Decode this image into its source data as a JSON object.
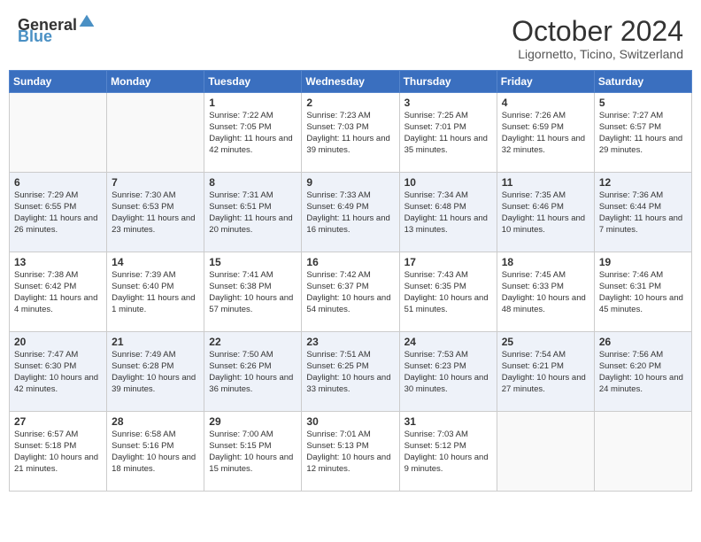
{
  "header": {
    "logo_general": "General",
    "logo_blue": "Blue",
    "month_title": "October 2024",
    "location": "Ligornetto, Ticino, Switzerland"
  },
  "days_of_week": [
    "Sunday",
    "Monday",
    "Tuesday",
    "Wednesday",
    "Thursday",
    "Friday",
    "Saturday"
  ],
  "weeks": [
    [
      {
        "day": "",
        "sunrise": "",
        "sunset": "",
        "daylight": ""
      },
      {
        "day": "",
        "sunrise": "",
        "sunset": "",
        "daylight": ""
      },
      {
        "day": "1",
        "sunrise": "Sunrise: 7:22 AM",
        "sunset": "Sunset: 7:05 PM",
        "daylight": "Daylight: 11 hours and 42 minutes."
      },
      {
        "day": "2",
        "sunrise": "Sunrise: 7:23 AM",
        "sunset": "Sunset: 7:03 PM",
        "daylight": "Daylight: 11 hours and 39 minutes."
      },
      {
        "day": "3",
        "sunrise": "Sunrise: 7:25 AM",
        "sunset": "Sunset: 7:01 PM",
        "daylight": "Daylight: 11 hours and 35 minutes."
      },
      {
        "day": "4",
        "sunrise": "Sunrise: 7:26 AM",
        "sunset": "Sunset: 6:59 PM",
        "daylight": "Daylight: 11 hours and 32 minutes."
      },
      {
        "day": "5",
        "sunrise": "Sunrise: 7:27 AM",
        "sunset": "Sunset: 6:57 PM",
        "daylight": "Daylight: 11 hours and 29 minutes."
      }
    ],
    [
      {
        "day": "6",
        "sunrise": "Sunrise: 7:29 AM",
        "sunset": "Sunset: 6:55 PM",
        "daylight": "Daylight: 11 hours and 26 minutes."
      },
      {
        "day": "7",
        "sunrise": "Sunrise: 7:30 AM",
        "sunset": "Sunset: 6:53 PM",
        "daylight": "Daylight: 11 hours and 23 minutes."
      },
      {
        "day": "8",
        "sunrise": "Sunrise: 7:31 AM",
        "sunset": "Sunset: 6:51 PM",
        "daylight": "Daylight: 11 hours and 20 minutes."
      },
      {
        "day": "9",
        "sunrise": "Sunrise: 7:33 AM",
        "sunset": "Sunset: 6:49 PM",
        "daylight": "Daylight: 11 hours and 16 minutes."
      },
      {
        "day": "10",
        "sunrise": "Sunrise: 7:34 AM",
        "sunset": "Sunset: 6:48 PM",
        "daylight": "Daylight: 11 hours and 13 minutes."
      },
      {
        "day": "11",
        "sunrise": "Sunrise: 7:35 AM",
        "sunset": "Sunset: 6:46 PM",
        "daylight": "Daylight: 11 hours and 10 minutes."
      },
      {
        "day": "12",
        "sunrise": "Sunrise: 7:36 AM",
        "sunset": "Sunset: 6:44 PM",
        "daylight": "Daylight: 11 hours and 7 minutes."
      }
    ],
    [
      {
        "day": "13",
        "sunrise": "Sunrise: 7:38 AM",
        "sunset": "Sunset: 6:42 PM",
        "daylight": "Daylight: 11 hours and 4 minutes."
      },
      {
        "day": "14",
        "sunrise": "Sunrise: 7:39 AM",
        "sunset": "Sunset: 6:40 PM",
        "daylight": "Daylight: 11 hours and 1 minute."
      },
      {
        "day": "15",
        "sunrise": "Sunrise: 7:41 AM",
        "sunset": "Sunset: 6:38 PM",
        "daylight": "Daylight: 10 hours and 57 minutes."
      },
      {
        "day": "16",
        "sunrise": "Sunrise: 7:42 AM",
        "sunset": "Sunset: 6:37 PM",
        "daylight": "Daylight: 10 hours and 54 minutes."
      },
      {
        "day": "17",
        "sunrise": "Sunrise: 7:43 AM",
        "sunset": "Sunset: 6:35 PM",
        "daylight": "Daylight: 10 hours and 51 minutes."
      },
      {
        "day": "18",
        "sunrise": "Sunrise: 7:45 AM",
        "sunset": "Sunset: 6:33 PM",
        "daylight": "Daylight: 10 hours and 48 minutes."
      },
      {
        "day": "19",
        "sunrise": "Sunrise: 7:46 AM",
        "sunset": "Sunset: 6:31 PM",
        "daylight": "Daylight: 10 hours and 45 minutes."
      }
    ],
    [
      {
        "day": "20",
        "sunrise": "Sunrise: 7:47 AM",
        "sunset": "Sunset: 6:30 PM",
        "daylight": "Daylight: 10 hours and 42 minutes."
      },
      {
        "day": "21",
        "sunrise": "Sunrise: 7:49 AM",
        "sunset": "Sunset: 6:28 PM",
        "daylight": "Daylight: 10 hours and 39 minutes."
      },
      {
        "day": "22",
        "sunrise": "Sunrise: 7:50 AM",
        "sunset": "Sunset: 6:26 PM",
        "daylight": "Daylight: 10 hours and 36 minutes."
      },
      {
        "day": "23",
        "sunrise": "Sunrise: 7:51 AM",
        "sunset": "Sunset: 6:25 PM",
        "daylight": "Daylight: 10 hours and 33 minutes."
      },
      {
        "day": "24",
        "sunrise": "Sunrise: 7:53 AM",
        "sunset": "Sunset: 6:23 PM",
        "daylight": "Daylight: 10 hours and 30 minutes."
      },
      {
        "day": "25",
        "sunrise": "Sunrise: 7:54 AM",
        "sunset": "Sunset: 6:21 PM",
        "daylight": "Daylight: 10 hours and 27 minutes."
      },
      {
        "day": "26",
        "sunrise": "Sunrise: 7:56 AM",
        "sunset": "Sunset: 6:20 PM",
        "daylight": "Daylight: 10 hours and 24 minutes."
      }
    ],
    [
      {
        "day": "27",
        "sunrise": "Sunrise: 6:57 AM",
        "sunset": "Sunset: 5:18 PM",
        "daylight": "Daylight: 10 hours and 21 minutes."
      },
      {
        "day": "28",
        "sunrise": "Sunrise: 6:58 AM",
        "sunset": "Sunset: 5:16 PM",
        "daylight": "Daylight: 10 hours and 18 minutes."
      },
      {
        "day": "29",
        "sunrise": "Sunrise: 7:00 AM",
        "sunset": "Sunset: 5:15 PM",
        "daylight": "Daylight: 10 hours and 15 minutes."
      },
      {
        "day": "30",
        "sunrise": "Sunrise: 7:01 AM",
        "sunset": "Sunset: 5:13 PM",
        "daylight": "Daylight: 10 hours and 12 minutes."
      },
      {
        "day": "31",
        "sunrise": "Sunrise: 7:03 AM",
        "sunset": "Sunset: 5:12 PM",
        "daylight": "Daylight: 10 hours and 9 minutes."
      },
      {
        "day": "",
        "sunrise": "",
        "sunset": "",
        "daylight": ""
      },
      {
        "day": "",
        "sunrise": "",
        "sunset": "",
        "daylight": ""
      }
    ]
  ]
}
